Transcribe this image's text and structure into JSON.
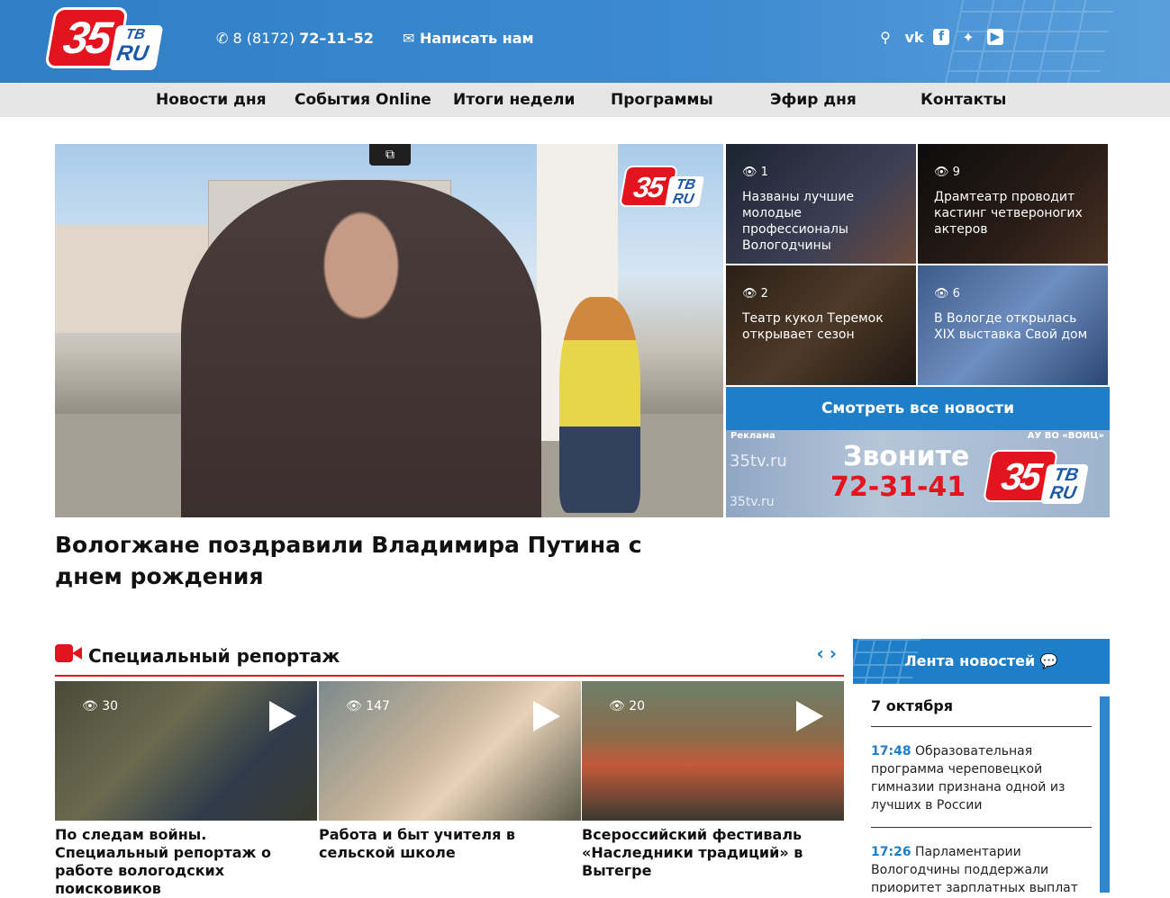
{
  "header": {
    "logo_number": "35",
    "logo_tv": "ТВ",
    "logo_ru": "RU",
    "phone_prefix": "8 (8172)",
    "phone_number": "72–11–52",
    "write_label": "Написать нам",
    "icons": [
      "search-icon",
      "vk-icon",
      "facebook-icon",
      "twitter-icon",
      "youtube-icon"
    ],
    "brand_color": "#3d8ad0",
    "accent_color": "#e3141d"
  },
  "nav": {
    "items": [
      "Новости дня",
      "События Online",
      "Итоги недели",
      "Программы",
      "Эфир дня",
      "Контакты"
    ]
  },
  "hero": {
    "headline": "Вологжане поздравили Владимира Путина с днем рождения",
    "watermark_number": "35",
    "watermark_tv": "ТВ",
    "watermark_ru": "RU"
  },
  "tiles": [
    {
      "views": "1",
      "title": "Названы лучшие молодые профессионалы Вологодчины"
    },
    {
      "views": "9",
      "title": "Драмтеатр проводит кастинг четвероногих актеров"
    },
    {
      "views": "2",
      "title": "Театр кукол Теремок открывает сезон"
    },
    {
      "views": "6",
      "title": "В Вологде открылась XIX выставка Свой дом"
    }
  ],
  "all_news_label": "Смотреть все новости",
  "ad": {
    "label": "Реклама",
    "org": "АУ ВО «ВОИЦ»",
    "site1": "35tv.ru",
    "site2": "35tv.ru",
    "call": "Звоните",
    "phone": "72-31-41",
    "logo_number": "35",
    "logo_tv": "ТВ",
    "logo_ru": "RU"
  },
  "special": {
    "title": "Специальный репортаж",
    "prev": "‹",
    "next": "›",
    "cards": [
      {
        "views": "30",
        "caption": "По следам войны. Специальный репортаж о работе вологодских поисковиков"
      },
      {
        "views": "147",
        "caption": "Работа и быт учителя в сельской школе"
      },
      {
        "views": "20",
        "caption": "Всероссийский фестиваль «Наследники традиций» в Вытегре"
      }
    ]
  },
  "lenta": {
    "title": "Лента новостей",
    "date": "7 октября",
    "items": [
      {
        "time": "17:48",
        "text": "Образовательная программа череповецкой гимназии признана одной из лучших в России"
      },
      {
        "time": "17:26",
        "text": "Парламентарии Вологодчины поддержали приоритет зарплатных выплат"
      }
    ]
  }
}
